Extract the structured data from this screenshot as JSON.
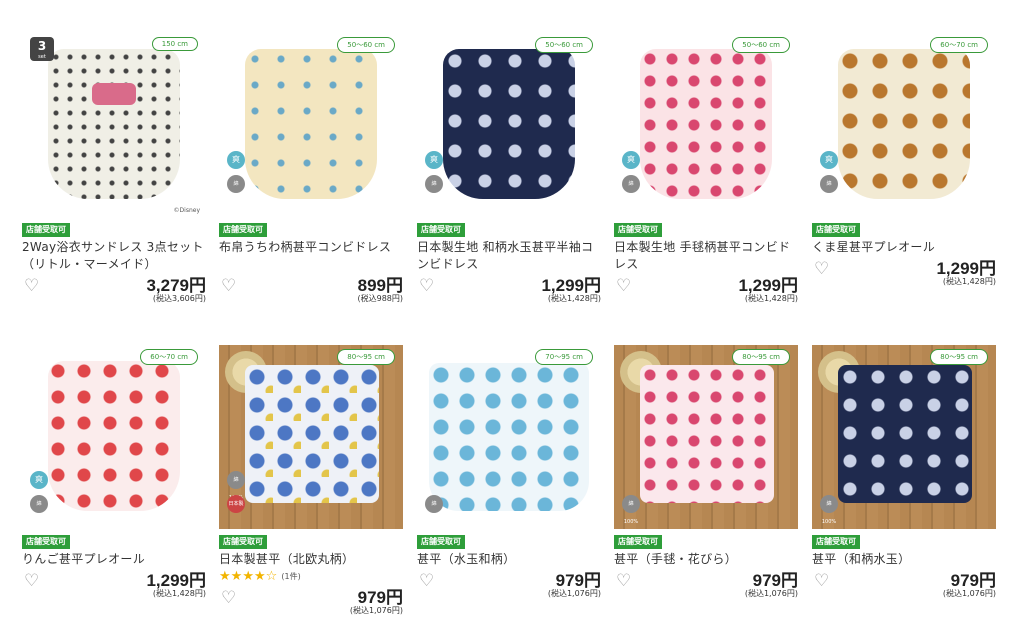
{
  "badges": {
    "set3_number": "3",
    "set3_word": "set",
    "cool": "爽",
    "cotton": "綿100%",
    "japan": "日本製",
    "disney": "©Disney"
  },
  "products": [
    {
      "size": "150 cm",
      "store": "店舗受取可",
      "title": "2Way浴衣サンドレス 3点セット（リトル・マーメイド）",
      "price": "3,279円",
      "tax": "(税込3,606円)"
    },
    {
      "size": "50～60 cm",
      "store": "店舗受取可",
      "title": "布帛うちわ柄甚平コンビドレス",
      "price": "899円",
      "tax": "(税込988円)"
    },
    {
      "size": "50～60 cm",
      "store": "店舗受取可",
      "title": "日本製生地 和柄水玉甚平半袖コンビドレス",
      "price": "1,299円",
      "tax": "(税込1,428円)"
    },
    {
      "size": "50～60 cm",
      "store": "店舗受取可",
      "title": "日本製生地 手毬柄甚平コンビドレス",
      "price": "1,299円",
      "tax": "(税込1,428円)"
    },
    {
      "size": "60～70 cm",
      "store": "店舗受取可",
      "title": "くま星甚平プレオール",
      "price": "1,299円",
      "tax": "(税込1,428円)"
    },
    {
      "size": "60～70 cm",
      "store": "店舗受取可",
      "title": "りんご甚平プレオール",
      "price": "1,299円",
      "tax": "(税込1,428円)"
    },
    {
      "size": "80～95 cm",
      "store": "店舗受取可",
      "title": "日本製甚平（北欧丸柄）",
      "rating": "4",
      "reviews": "(1件)",
      "price": "979円",
      "tax": "(税込1,076円)"
    },
    {
      "size": "70～95 cm",
      "store": "店舗受取可",
      "title": "甚平（水玉和柄）",
      "price": "979円",
      "tax": "(税込1,076円)"
    },
    {
      "size": "80～95 cm",
      "store": "店舗受取可",
      "title": "甚平（手毬・花びら）",
      "price": "979円",
      "tax": "(税込1,076円)"
    },
    {
      "size": "80～95 cm",
      "store": "店舗受取可",
      "title": "甚平（和柄水玉）",
      "price": "979円",
      "tax": "(税込1,076円)"
    }
  ],
  "colors": {
    "store_green": "#2e9e3a",
    "size_green": "#3a9a3a"
  }
}
